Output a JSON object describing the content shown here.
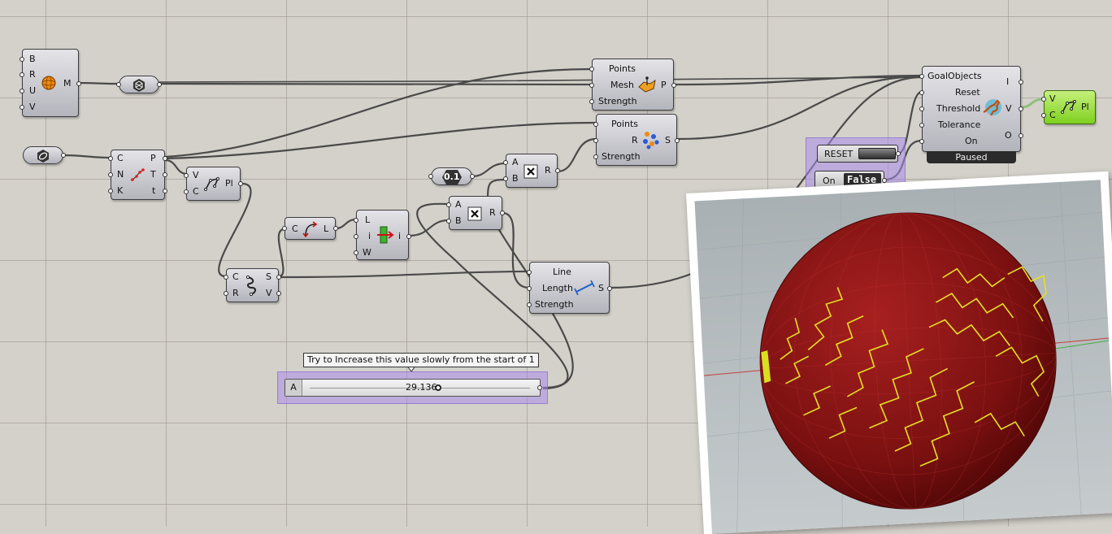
{
  "components": {
    "sphere": {
      "inputs": [
        "B",
        "R",
        "U",
        "V"
      ],
      "outputs": [
        "M"
      ],
      "icon": "sphere-icon"
    },
    "mesh_convert": {
      "icon": "mesh-icon"
    },
    "curve_param": {
      "icon": "curve-param-icon"
    },
    "divide_curve": {
      "inputs": [
        "C",
        "N",
        "K"
      ],
      "outputs": [
        "P",
        "T",
        "t"
      ],
      "icon": "divide-curve-icon"
    },
    "polyline_a": {
      "inputs": [
        "V",
        "C"
      ],
      "outputs": [
        "Pl"
      ],
      "icon": "polyline-icon"
    },
    "on_mesh": {
      "inputs": [
        "Points",
        "Mesh",
        "Strength"
      ],
      "outputs": [
        "P"
      ],
      "icon": "onmesh-goal-icon"
    },
    "sphere_collide": {
      "inputs": [
        "Points",
        "R",
        "Strength"
      ],
      "outputs": [
        "S"
      ],
      "icon": "sphere-collide-icon"
    },
    "number_param": {
      "value": "0.1"
    },
    "multiply_a": {
      "inputs": [
        "A",
        "B"
      ],
      "outputs": [
        "R"
      ],
      "icon": "multiply-icon"
    },
    "multiply_b": {
      "inputs": [
        "A",
        "B"
      ],
      "outputs": [
        "R"
      ],
      "icon": "multiply-icon"
    },
    "length": {
      "inputs": [
        "C"
      ],
      "outputs": [
        "L"
      ],
      "icon": "length-icon"
    },
    "list_length": {
      "inputs": [
        "L",
        "i",
        "W"
      ],
      "outputs": [
        "i"
      ],
      "icon": "list-item-icon"
    },
    "explode": {
      "inputs": [
        "C",
        "R"
      ],
      "outputs": [
        "S",
        "V"
      ],
      "icon": "explode-icon"
    },
    "line_length": {
      "inputs": [
        "Line",
        "Length",
        "Strength"
      ],
      "outputs": [
        "S"
      ],
      "icon": "length-goal-icon"
    },
    "solver": {
      "inputs": [
        "GoalObjects",
        "Reset",
        "Threshold",
        "Tolerance",
        "On"
      ],
      "outputs": [
        "I",
        "V",
        "O"
      ],
      "status": "Paused",
      "icon": "kangaroo-icon"
    },
    "polyline_b": {
      "inputs": [
        "V",
        "C"
      ],
      "outputs": [
        "Pl"
      ],
      "icon": "polyline-icon"
    }
  },
  "reset_button": {
    "label": "RESET"
  },
  "toggle": {
    "label": "On",
    "value": "False"
  },
  "slider": {
    "name": "A",
    "value": "29.136",
    "tooltip": "Try to Increase this value slowly from the start of 1"
  },
  "colors": {
    "canvas": "#d4d1ca",
    "component": "#c8c8ce",
    "group": "#a98ce8",
    "preview_green": "#8fd42a",
    "sphere_red": "#8a1515",
    "pattern_yellow": "#e8e020"
  }
}
